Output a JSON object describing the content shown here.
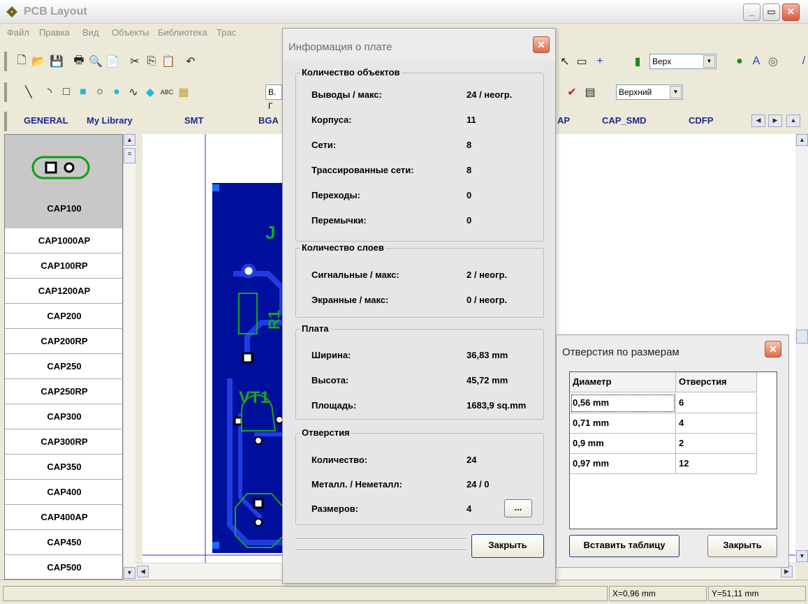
{
  "window": {
    "title": "PCB Layout",
    "minimize": "_",
    "maximize": "▭",
    "close": "✕"
  },
  "menu": [
    "Файл",
    "Правка",
    "Вид",
    "Объекты",
    "Библиотека",
    "Трас"
  ],
  "toolbar1": {
    "layer_combo": "Верх"
  },
  "toolbar2": {
    "text_combo": "В. Г",
    "layer_combo": "Верхний"
  },
  "library_tabs": [
    "GENERAL",
    "My Library",
    "SMT",
    "BGA",
    "AP",
    "CAP_SMD",
    "CDFP"
  ],
  "components": [
    "CAP100",
    "CAP1000AP",
    "CAP100RP",
    "CAP1200AP",
    "CAP200",
    "CAP200RP",
    "CAP250",
    "CAP250RP",
    "CAP300",
    "CAP300RP",
    "CAP350",
    "CAP400",
    "CAP400AP",
    "CAP450",
    "CAP500"
  ],
  "selected_component": "CAP100",
  "pcb_labels": {
    "r1": "R1",
    "vt1": "VT1",
    "j": "J"
  },
  "status": {
    "x": "X=0,96 mm",
    "y": "Y=51,11 mm"
  },
  "info_dialog": {
    "title": "Информация о плате",
    "objects": {
      "caption": "Количество объектов",
      "rows": [
        {
          "label": "Выводы / макс:",
          "value": "24 / неогр."
        },
        {
          "label": "Корпуса:",
          "value": "11"
        },
        {
          "label": "Сети:",
          "value": "8"
        },
        {
          "label": "Трассированные сети:",
          "value": "8"
        },
        {
          "label": "Переходы:",
          "value": "0"
        },
        {
          "label": "Перемычки:",
          "value": "0"
        }
      ]
    },
    "layers": {
      "caption": "Количество слоев",
      "rows": [
        {
          "label": "Сигнальные / макс:",
          "value": "2 / неогр."
        },
        {
          "label": "Экранные / макс:",
          "value": "0 / неогр."
        }
      ]
    },
    "board": {
      "caption": "Плата",
      "rows": [
        {
          "label": "Ширина:",
          "value": "36,83 mm"
        },
        {
          "label": "Высота:",
          "value": "45,72 mm"
        },
        {
          "label": "Площадь:",
          "value": "1683,9 sq.mm"
        }
      ]
    },
    "holes": {
      "caption": "Отверстия",
      "rows": [
        {
          "label": "Количество:",
          "value": "24"
        },
        {
          "label": "Металл. / Неметалл:",
          "value": "24 / 0"
        },
        {
          "label": "Размеров:",
          "value": "4"
        }
      ],
      "details_button": "..."
    },
    "close_button": "Закрыть"
  },
  "holes_dialog": {
    "title": "Отверстия по размерам",
    "columns": [
      "Диаметр",
      "Отверстия"
    ],
    "rows": [
      [
        "0,56 mm",
        "6"
      ],
      [
        "0,71 mm",
        "4"
      ],
      [
        "0,9 mm",
        "2"
      ],
      [
        "0,97 mm",
        "12"
      ]
    ],
    "insert_button": "Вставить таблицу",
    "close_button": "Закрыть"
  },
  "colors": {
    "board": "#000f9c",
    "trace": "#1930d8",
    "silk": "#1aa51a",
    "selection": "#c8c8c8"
  }
}
